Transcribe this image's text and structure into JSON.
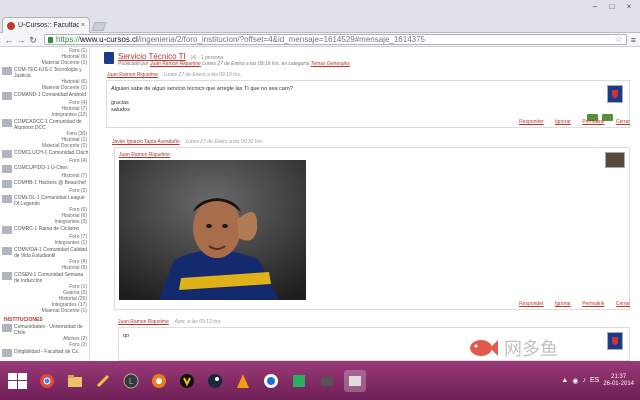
{
  "browser": {
    "tab_title": "U-Cursos:: Facultad de C",
    "tab_close": "×",
    "url_scheme": "https://",
    "url_host": "www.u-cursos.cl",
    "url_path": "/ingenieria/2/foro_institucion/?offset=4&id_mensaje=1614529#mensaje_1614375",
    "window_buttons": [
      "–",
      "□",
      "×"
    ]
  },
  "sidebar": {
    "lines": [
      {
        "text": "Foro (1)",
        "align": "right"
      },
      {
        "text": "Historial (6)",
        "align": "right"
      },
      {
        "text": "Material Docente (1)",
        "align": "right"
      },
      {
        "text": "COM-TEC-ILIS-1 Tecnología y Justicia",
        "align": "entry"
      },
      {
        "text": "Historial (6)",
        "align": "right"
      },
      {
        "text": "Material Docente (1)",
        "align": "right"
      },
      {
        "text": "COMAND-1 Comunidad Android",
        "align": "entry"
      },
      {
        "text": "Foro (4)",
        "align": "right"
      },
      {
        "text": "Historial (7)",
        "align": "right"
      },
      {
        "text": "Integrantes (12)",
        "align": "right"
      },
      {
        "text": "COMCADCC-1 Comunidad de Alumnos DCC",
        "align": "entry"
      },
      {
        "text": "Foro (30)",
        "align": "right"
      },
      {
        "text": "Historial (1)",
        "align": "right"
      },
      {
        "text": "Material Docente (1)",
        "align": "right"
      },
      {
        "text": "COMCLUCH-1 Comunidad Clach",
        "align": "entry"
      },
      {
        "text": "Foro (4)",
        "align": "right"
      },
      {
        "text": "COMCUPIDO-1 U-Cites",
        "align": "entry"
      },
      {
        "text": "Historial (7)",
        "align": "right"
      },
      {
        "text": "COMHB-1 Hackers @ Beauchef",
        "align": "entry"
      },
      {
        "text": "Foro (2)",
        "align": "right"
      },
      {
        "text": "COMLOL-1 Comunidad League Of Legends",
        "align": "entry"
      },
      {
        "text": "Foro (6)",
        "align": "right"
      },
      {
        "text": "Historial (6)",
        "align": "right"
      },
      {
        "text": "Integrantes (3)",
        "align": "right"
      },
      {
        "text": "COMRC-1 Rama de Ciclismo",
        "align": "entry"
      },
      {
        "text": "Foro (7)",
        "align": "right"
      },
      {
        "text": "Integrantes (1)",
        "align": "right"
      },
      {
        "text": "COMVIDA-1 Comunidad Calidad de Vida Estudiantil",
        "align": "entry"
      },
      {
        "text": "Foro (4)",
        "align": "right"
      },
      {
        "text": "Historial (6)",
        "align": "right"
      },
      {
        "text": "COSEN-1 Comunidad Semana de Inducción",
        "align": "entry"
      },
      {
        "text": "Foro (1)",
        "align": "right"
      },
      {
        "text": "Galería (2)",
        "align": "right"
      },
      {
        "text": "Historial (25)",
        "align": "right"
      },
      {
        "text": "Integrantes (17)",
        "align": "right"
      },
      {
        "text": "Material Docente (1)",
        "align": "right"
      },
      {
        "text": "INSTITUCIONES",
        "align": "header"
      },
      {
        "text": "Comunidades - Universidad de Chile",
        "align": "entry"
      },
      {
        "text": "Afiches (2)",
        "align": "right"
      },
      {
        "text": "Foro (2)",
        "align": "right"
      },
      {
        "text": "Dirigibilidad - Facultad de Cs.",
        "align": "entry"
      }
    ]
  },
  "thread": {
    "title": "Servicio Técnico TI",
    "title_meta": "(4) · 1 persona",
    "subtitle_prefix": "Publicado por",
    "subtitle_author": "Juan Ramon Riquelme",
    "subtitle_date": "Lunes 27 de Enero a las 09:19 hrs.",
    "subtitle_cat_prefix": "en categoría",
    "subtitle_category": "Temas Generales"
  },
  "posts": [
    {
      "author": "Juan Ramon Riquelme",
      "date": "Lunes 27 de Enero a las 09:19 hrs.",
      "body_line1": "Alguien sabe de algun servicio técnico que arregle las TI que no sea caro?",
      "body_line2": "gracias",
      "body_line3": "saludos"
    },
    {
      "author": "Javier Ignacio Tapia Avendaño",
      "date": "Lunes 27 de Enero a las 09:31 hrs.",
      "quoted_author": "Juan Ramon Riquelme"
    },
    {
      "author": "Juan Ramon Riquelme",
      "date": "Ayer, a las 09:12 hrs.",
      "body_line1": "qo"
    }
  ],
  "actions": {
    "reply": "Responder",
    "ignore": "Ignorar",
    "permalink": "Permalink",
    "close": "Cerrar"
  },
  "watermark": {
    "text": "网多鱼"
  },
  "taskbar": {
    "apps": [
      "chrome",
      "explorer",
      "tool",
      "league",
      "media",
      "winamp",
      "steam",
      "vlc",
      "app",
      "game",
      "app2",
      "active"
    ],
    "clock_time": "21:37",
    "clock_date": "26-01-2014",
    "tray_items": [
      "▲",
      "◉",
      "♪",
      "ES"
    ]
  },
  "colors": {
    "accent": "#b9342c",
    "taskbar": "#7a2660",
    "udechile_blue": "#1a3a8c"
  }
}
